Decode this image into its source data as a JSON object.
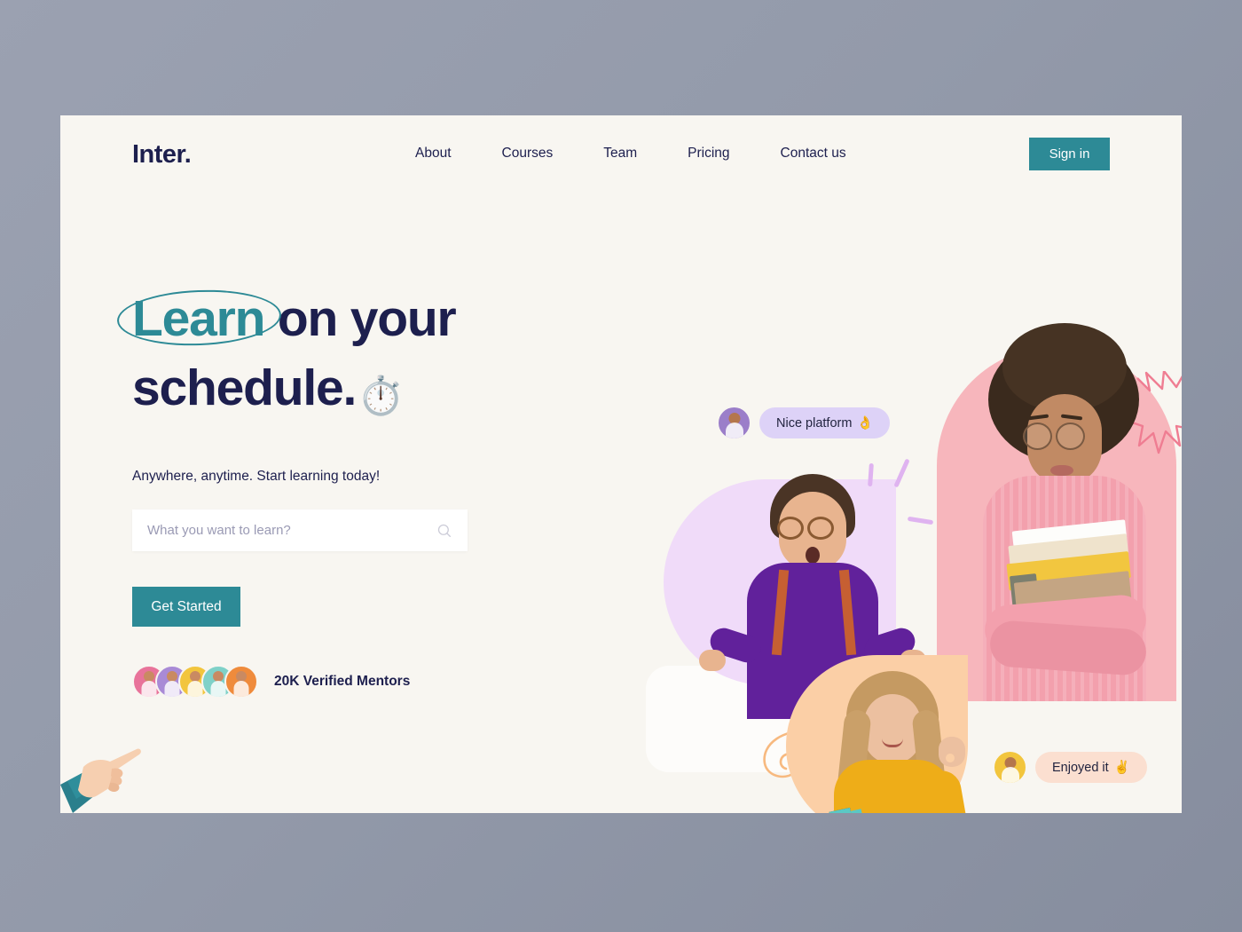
{
  "brand": {
    "logo": "Inter.",
    "accent": "#2d8a96",
    "ink": "#1d1f4e",
    "card_bg": "#f8f6f1"
  },
  "nav": {
    "links": [
      {
        "label": "About"
      },
      {
        "label": "Courses"
      },
      {
        "label": "Team"
      },
      {
        "label": "Pricing"
      },
      {
        "label": "Contact us"
      }
    ],
    "signin_label": "Sign in"
  },
  "hero": {
    "headline_highlight": "Learn",
    "headline_rest": " on your",
    "headline_line2": "schedule.",
    "headline_emoji": "⏱️",
    "subtitle": "Anywhere, anytime. Start learning today!",
    "search_placeholder": "What you want to learn?",
    "search_value": "",
    "search_icon": "search-icon",
    "cta_label": "Get Started",
    "mentors_text": "20K Verified Mentors",
    "mentor_avatar_colors": [
      "#e8739a",
      "#a98ad6",
      "#f2c53d",
      "#7fd1c8",
      "#ef8b3c"
    ]
  },
  "testimonials": [
    {
      "text": "Nice platform",
      "emoji": "👌",
      "bubble_color": "#ddd2f7",
      "avatar_color": "#9b7ec9"
    },
    {
      "text": "Enjoyed it",
      "emoji": "✌️",
      "bubble_color": "#fbdfd0",
      "avatar_color": "#f2c53d"
    }
  ],
  "artwork": {
    "pink_arch_color": "#f7b6bc",
    "lavender_blob_color": "#f0dbf9",
    "peach_blob_color": "#fbcfa6",
    "zigzag_color": "#ef7d92",
    "purple_mark_color": "#dfb3f0",
    "pointing_hand_emoji": "👉"
  }
}
